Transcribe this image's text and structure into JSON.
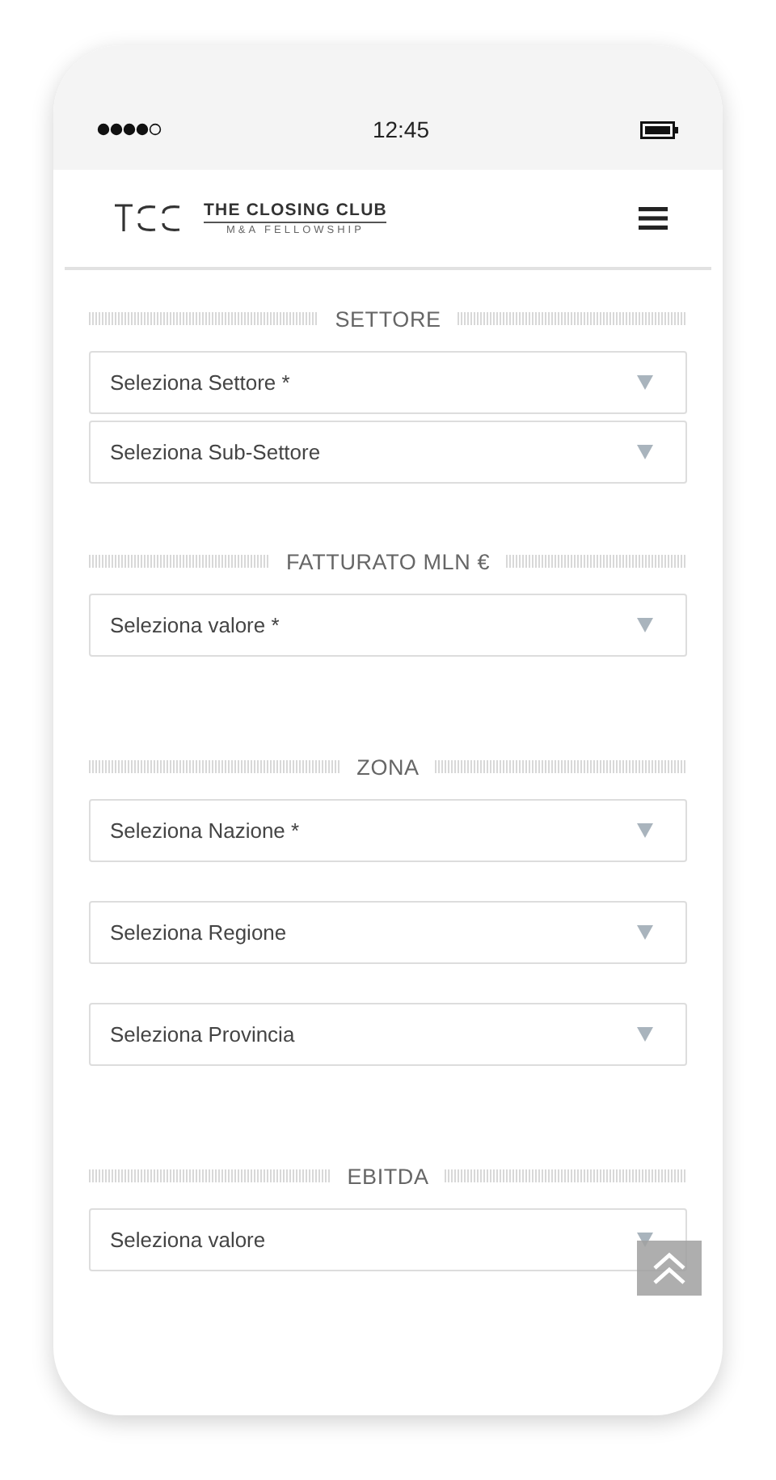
{
  "status_bar": {
    "time": "12:45"
  },
  "header": {
    "brand": "THE CLOSING CLUB",
    "tagline": "M&A FELLOWSHIP"
  },
  "sections": [
    {
      "title": "SETTORE",
      "selects": [
        {
          "placeholder": "Seleziona Settore *"
        },
        {
          "placeholder": "Seleziona Sub-Settore"
        }
      ]
    },
    {
      "title": "FATTURATO MLN €",
      "selects": [
        {
          "placeholder": "Seleziona valore *"
        }
      ]
    },
    {
      "title": "ZONA",
      "selects": [
        {
          "placeholder": "Seleziona Nazione *"
        },
        {
          "placeholder": "Seleziona Regione"
        },
        {
          "placeholder": "Seleziona Provincia"
        }
      ]
    },
    {
      "title": "EBITDA",
      "selects": [
        {
          "placeholder": "Seleziona valore"
        }
      ]
    }
  ]
}
